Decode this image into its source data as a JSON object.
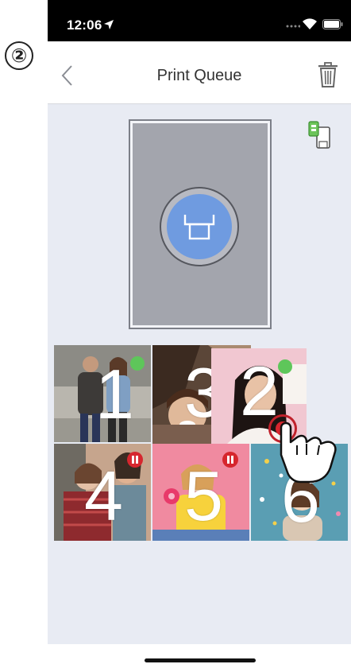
{
  "step_number": "②",
  "status_bar": {
    "time": "12:06"
  },
  "nav": {
    "title": "Print Queue"
  },
  "queue": {
    "items": [
      {
        "number": "1",
        "status": "ready"
      },
      {
        "number": "3",
        "status": "printing"
      },
      {
        "number": "2",
        "status": "ready"
      },
      {
        "number": "4",
        "status": "paused"
      },
      {
        "number": "5",
        "status": "paused"
      },
      {
        "number": "6",
        "status": "ready"
      }
    ]
  },
  "colors": {
    "accent_blue": "#6f9be0",
    "ready_green": "#5ec65a",
    "pause_red": "#d6262e",
    "background": "#e8ebf3"
  }
}
